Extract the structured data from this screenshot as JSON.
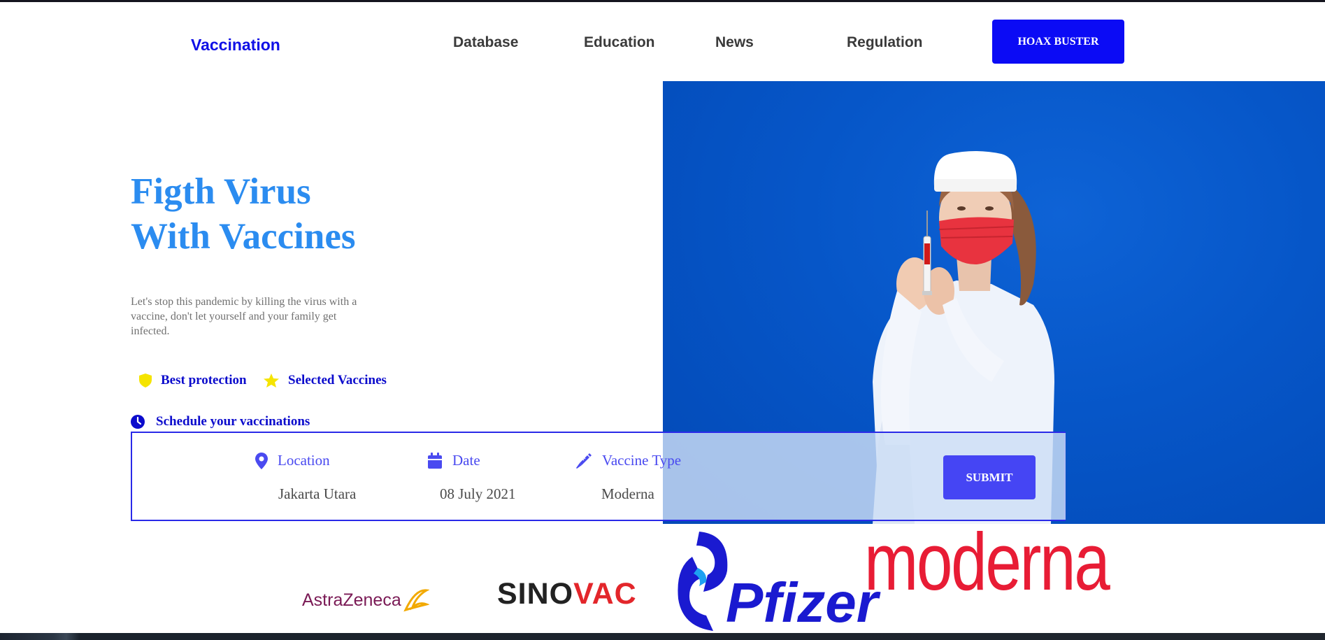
{
  "nav": {
    "brand": "Vaccination",
    "links": [
      {
        "label": "Database"
      },
      {
        "label": "Education"
      },
      {
        "label": "News"
      },
      {
        "label": "Regulation"
      }
    ],
    "cta_label": "HOAX BUSTER"
  },
  "hero": {
    "title_line1": "Figth Virus",
    "title_line2": "With Vaccines",
    "description": "Let's stop this pandemic by killing the virus with a vaccine, don't let yourself and your family get infected.",
    "features": [
      {
        "label": "Best protection",
        "icon": "shield-icon"
      },
      {
        "label": "Selected Vaccines",
        "icon": "star-icon"
      }
    ],
    "schedule_label": "Schedule your vaccinations",
    "image_alt": "nurse-with-syringe-photo"
  },
  "booking": {
    "location": {
      "label": "Location",
      "value": "Jakarta Utara",
      "icon": "map-pin-icon"
    },
    "date": {
      "label": "Date",
      "value": "08 July 2021",
      "icon": "calendar-icon"
    },
    "vaccine_type": {
      "label": "Vaccine Type",
      "value": "Moderna",
      "icon": "syringe-icon"
    },
    "submit_label": "SUBMIT"
  },
  "partners": {
    "astrazeneca": "AstraZeneca",
    "sinovac_a": "SINO",
    "sinovac_b": "VAC",
    "pfizer": "Pfizer",
    "moderna": "moderna"
  },
  "colors": {
    "brand_blue": "#1010e6",
    "accent_blue": "#2b8cf0",
    "button_blue": "#0b0bf5",
    "photo_bg": "#0656c8",
    "feature_yellow": "#f5e400"
  }
}
